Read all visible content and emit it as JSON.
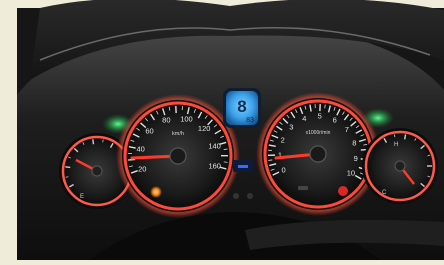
{
  "speedometer": {
    "tick_labels": [
      "20",
      "40",
      "60",
      "80",
      "100",
      "120",
      "140",
      "160"
    ],
    "unit": "km/h"
  },
  "tachometer": {
    "tick_labels": [
      "0",
      "1",
      "2",
      "3",
      "4",
      "5",
      "6",
      "7",
      "8",
      "9",
      "10"
    ],
    "unit": "x1000r/min"
  },
  "lcd": {
    "gear": "8",
    "value": "83"
  },
  "right_gauge": {
    "top_label": "H",
    "bottom_label": "C"
  },
  "left_gauge": {
    "bottom_label": "E"
  },
  "colors": {
    "ring_red": "#ff4a3a",
    "lcd_blue": "#3fa8e8",
    "indicator_green": "#1fd35a",
    "warning_orange": "#ff8c1a",
    "background": "#f0ecda"
  },
  "icons": [
    "left-turn-signal-icon",
    "right-turn-signal-icon",
    "high-beam-icon",
    "oil-warning-icon"
  ]
}
